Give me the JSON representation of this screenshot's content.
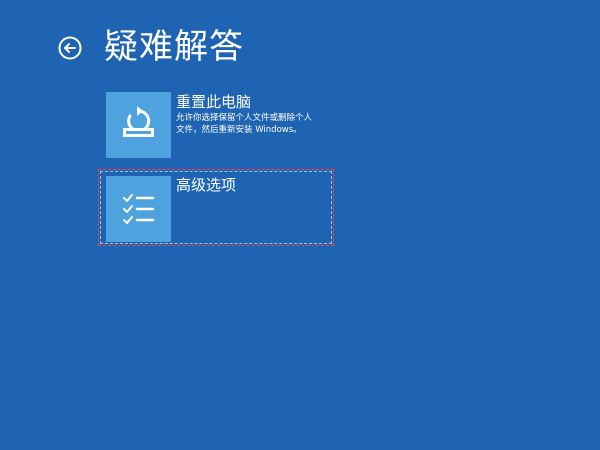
{
  "header": {
    "back_icon": "back-arrow-circle-icon",
    "title": "疑难解答"
  },
  "options": [
    {
      "icon": "reset-pc-icon",
      "title": "重置此电脑",
      "description": "允许你选择保留个人文件或删除个人\n文件，然后重新安装 Windows。"
    },
    {
      "icon": "checklist-icon",
      "title": "高级选项",
      "selected": true
    }
  ],
  "colors": {
    "background": "#1f64b3",
    "tile": "#4ea3de",
    "text": "#ffffff",
    "selection_border": "#ff3b3b"
  }
}
